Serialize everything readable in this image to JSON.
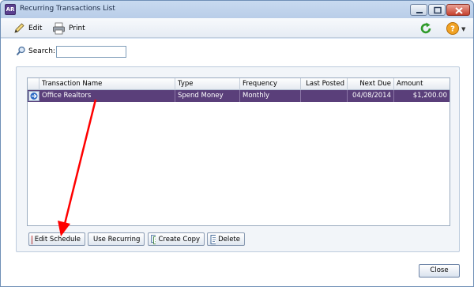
{
  "window": {
    "app_icon_text": "AR",
    "title": "Recurring Transactions List",
    "controls": {
      "minimize": "minimize-icon",
      "maximize": "maximize-icon",
      "close": "close-icon"
    }
  },
  "toolbar": {
    "edit_label": "Edit",
    "print_label": "Print",
    "icons": [
      "pencil-icon",
      "printer-icon",
      "refresh-icon",
      "help-icon"
    ]
  },
  "search": {
    "label": "Search:",
    "value": ""
  },
  "grid": {
    "columns": [
      "Transaction Name",
      "Type",
      "Frequency",
      "Last Posted",
      "Next Due",
      "Amount"
    ],
    "rows": [
      {
        "name": "Office Realtors",
        "type": "Spend Money",
        "frequency": "Monthly",
        "last_posted": "",
        "next_due": "04/08/2014",
        "amount": "$1,200.00"
      }
    ]
  },
  "actions": {
    "edit_schedule": "Edit Schedule",
    "use_recurring": "Use Recurring",
    "create_copy": "Create Copy",
    "delete": "Delete"
  },
  "footer": {
    "close_label": "Close"
  },
  "colors": {
    "selected_row": "#5a3f7a",
    "annotation_arrow": "#ff0000"
  }
}
